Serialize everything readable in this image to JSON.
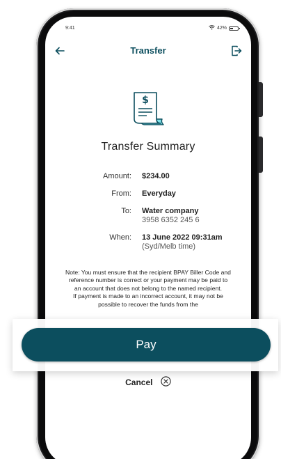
{
  "status_bar": {
    "time": "9:41",
    "battery_percent": "42%",
    "battery_level": 0.42
  },
  "header": {
    "title": "Transfer",
    "back_icon": "arrow-left-icon",
    "exit_icon": "logout-icon"
  },
  "summary": {
    "title": "Transfer Summary",
    "illustration": "receipt-dollar-icon",
    "rows": [
      {
        "label": "Amount:",
        "value": "$234.00",
        "sub": ""
      },
      {
        "label": "From:",
        "value": "Everyday",
        "sub": ""
      },
      {
        "label": "To:",
        "value": "Water company",
        "sub": "3958 6352 245 6"
      },
      {
        "label": "When:",
        "value": "13 June 2022 09:31am",
        "sub": "(Syd/Melb time)"
      }
    ]
  },
  "note": {
    "paragraph1": "Note: You must ensure that the recipient BPAY Biller Code and reference number is correct or your payment may be paid to an account that does not belong to the named recipient.",
    "paragraph2": "If payment is made to an incorrect account, it may not be possible to recover the funds from the"
  },
  "actions": {
    "pay_label": "Pay",
    "cancel_label": "Cancel",
    "cancel_icon": "close-circle-icon"
  },
  "colors": {
    "brand": "#0c4e5e",
    "receipt_accent": "#7fe3ea"
  }
}
